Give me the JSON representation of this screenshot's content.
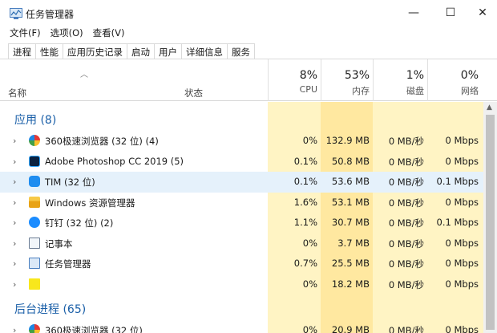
{
  "window": {
    "title": "任务管理器"
  },
  "window_controls": {
    "minimize": "—",
    "maximize": "☐",
    "close": "✕"
  },
  "menu": [
    "文件(F)",
    "选项(O)",
    "查看(V)"
  ],
  "tabs": [
    "进程",
    "性能",
    "应用历史记录",
    "启动",
    "用户",
    "详细信息",
    "服务"
  ],
  "columns": {
    "name": "名称",
    "status": "状态",
    "cpu": {
      "pct": "8%",
      "label": "CPU"
    },
    "memory": {
      "pct": "53%",
      "label": "内存"
    },
    "disk": {
      "pct": "1%",
      "label": "磁盘"
    },
    "network": {
      "pct": "0%",
      "label": "网络"
    }
  },
  "groups": {
    "apps": "应用 (8)",
    "background": "后台进程 (65)"
  },
  "apps": [
    {
      "name": "360极速浏览器 (32 位) (4)",
      "icon": "browser-360-icon",
      "cpu": "0%",
      "memory": "132.9 MB",
      "disk": "0 MB/秒",
      "network": "0 Mbps"
    },
    {
      "name": "Adobe Photoshop CC 2019 (5)",
      "icon": "photoshop-icon",
      "cpu": "0.1%",
      "memory": "50.8 MB",
      "disk": "0 MB/秒",
      "network": "0 Mbps"
    },
    {
      "name": "TIM (32 位)",
      "icon": "tim-icon",
      "cpu": "0.1%",
      "memory": "53.6 MB",
      "disk": "0 MB/秒",
      "network": "0.1 Mbps"
    },
    {
      "name": "Windows 资源管理器",
      "icon": "folder-icon",
      "cpu": "1.6%",
      "memory": "53.1 MB",
      "disk": "0 MB/秒",
      "network": "0 Mbps"
    },
    {
      "name": "钉钉 (32 位) (2)",
      "icon": "dingtalk-icon",
      "cpu": "1.1%",
      "memory": "30.7 MB",
      "disk": "0 MB/秒",
      "network": "0.1 Mbps"
    },
    {
      "name": "记事本",
      "icon": "notepad-icon",
      "cpu": "0%",
      "memory": "3.7 MB",
      "disk": "0 MB/秒",
      "network": "0 Mbps"
    },
    {
      "name": "任务管理器",
      "icon": "task-manager-icon",
      "cpu": "0.7%",
      "memory": "25.5 MB",
      "disk": "0 MB/秒",
      "network": "0 Mbps"
    },
    {
      "name": "",
      "icon": "sticky-notes-icon",
      "cpu": "0%",
      "memory": "18.2 MB",
      "disk": "0 MB/秒",
      "network": "0 Mbps"
    }
  ],
  "background": [
    {
      "name": "360极速浏览器 (32 位)",
      "icon": "browser-360-icon",
      "cpu": "0%",
      "memory": "20.9 MB",
      "disk": "0 MB/秒",
      "network": "0 Mbps"
    }
  ],
  "colors": {
    "heat_light": "#fff4c4",
    "heat_medium": "#ffe8a0",
    "selected_row": "#e5f1fb",
    "group_text": "#1a5fa8"
  }
}
